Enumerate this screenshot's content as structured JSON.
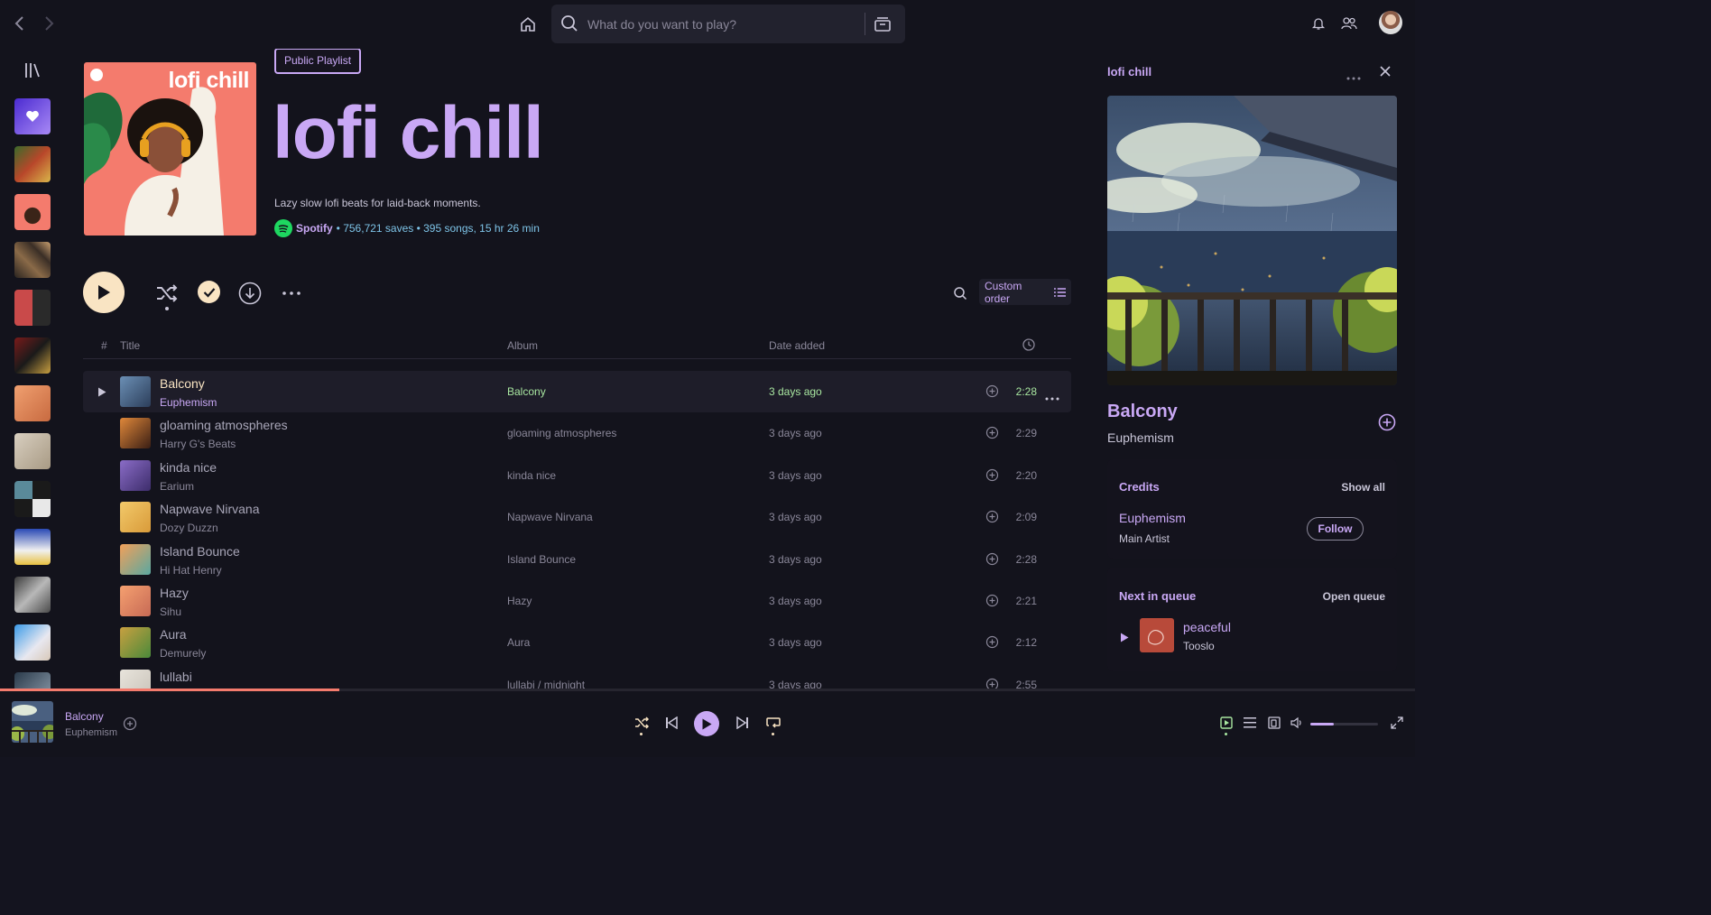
{
  "search": {
    "placeholder": "What do you want to play?"
  },
  "playlist": {
    "badge": "Public Playlist",
    "cover_title": "lofi chill",
    "title": "lofi chill",
    "description": "Lazy slow lofi beats for laid-back moments.",
    "owner": "Spotify",
    "stats": "• 756,721 saves • 395 songs, 15 hr 26 min"
  },
  "controls": {
    "sort_label": "Custom order"
  },
  "table": {
    "headers": {
      "index": "#",
      "title": "Title",
      "album": "Album",
      "date": "Date added"
    },
    "rows": [
      {
        "title": "Balcony",
        "artist": "Euphemism",
        "album": "Balcony",
        "date": "3 days ago",
        "duration": "2:28",
        "active": true,
        "c1": "#6b8fb5",
        "c2": "#2c3e5a"
      },
      {
        "title": "gloaming atmospheres",
        "artist": "Harry G's Beats",
        "album": "gloaming atmospheres",
        "date": "3 days ago",
        "duration": "2:29",
        "c1": "#e0883a",
        "c2": "#3a1e14"
      },
      {
        "title": "kinda nice",
        "artist": "Earium",
        "album": "kinda nice",
        "date": "3 days ago",
        "duration": "2:20",
        "c1": "#8a6cc7",
        "c2": "#3d2d6b"
      },
      {
        "title": "Napwave Nirvana",
        "artist": "Dozy Duzzn",
        "album": "Napwave Nirvana",
        "date": "3 days ago",
        "duration": "2:09",
        "c1": "#f2c96a",
        "c2": "#d99b3a"
      },
      {
        "title": "Island Bounce",
        "artist": "Hi Hat Henry",
        "album": "Island Bounce",
        "date": "3 days ago",
        "duration": "2:28",
        "c1": "#f2a05a",
        "c2": "#5aa8a0"
      },
      {
        "title": "Hazy",
        "artist": "Sihu",
        "album": "Hazy",
        "date": "3 days ago",
        "duration": "2:21",
        "c1": "#f5a070",
        "c2": "#c76a55"
      },
      {
        "title": "Aura",
        "artist": "Demurely",
        "album": "Aura",
        "date": "3 days ago",
        "duration": "2:12",
        "c1": "#c9a040",
        "c2": "#4a8a3a"
      },
      {
        "title": "lullabi",
        "artist": "",
        "album": "lullabi / midnight",
        "date": "3 days ago",
        "duration": "2:55",
        "c1": "#e8e4dc",
        "c2": "#c8c2b8"
      }
    ]
  },
  "right_panel": {
    "title": "lofi chill",
    "song": "Balcony",
    "artist": "Euphemism",
    "credits": {
      "heading": "Credits",
      "show_all": "Show all",
      "artist": "Euphemism",
      "role": "Main Artist",
      "follow": "Follow"
    },
    "queue": {
      "heading": "Next in queue",
      "open": "Open queue",
      "song": "peaceful",
      "artist": "Tooslo"
    }
  },
  "player": {
    "title": "Balcony",
    "artist": "Euphemism",
    "progress": 0.24,
    "volume": 0.35
  },
  "colors": {
    "accent": "#c9a8f5",
    "cream": "#f9e4c3",
    "green": "#a8e6a0",
    "coral": "#f47b6d"
  }
}
